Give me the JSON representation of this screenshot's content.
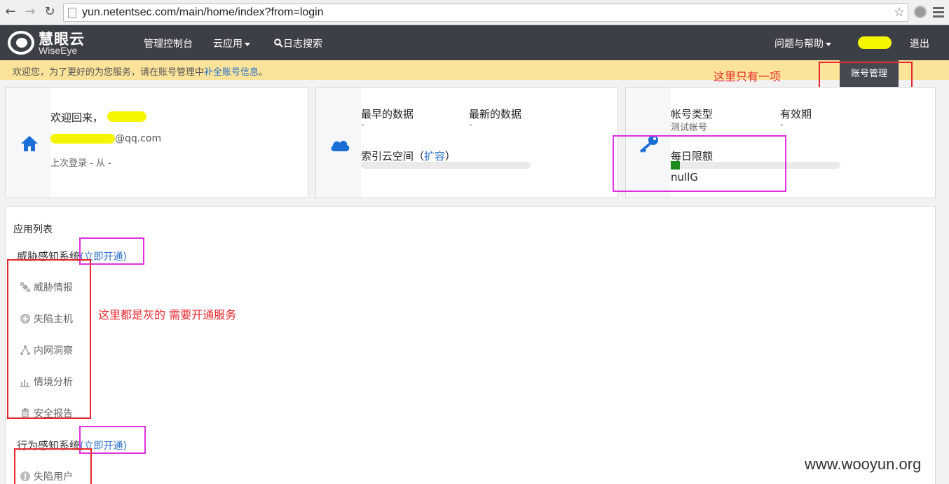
{
  "browser": {
    "url": "yun.netentsec.com/main/home/index?from=login"
  },
  "header": {
    "logo_cn": "慧眼云",
    "logo_en": "WiseEye",
    "nav": [
      "管理控制台",
      "云应用",
      "日志搜索"
    ],
    "help": "问题与帮助",
    "logout": "退出"
  },
  "notice": {
    "text": "欢迎您，为了更好的为您服务，请在账号管理中",
    "link": "补全账号信息",
    "suffix": "。",
    "account_button": "账号管理"
  },
  "annotations": {
    "only_one": "这里只有一项",
    "grey_items": "这里都是灰的 需要开通服务"
  },
  "card_user": {
    "welcome": "欢迎回来，",
    "email_suffix": "@qq.com",
    "last_login": "上次登录 - 从 -"
  },
  "card_data": {
    "earliest_label": "最早的数据",
    "earliest_value": "-",
    "latest_label": "最新的数据",
    "latest_value": "-",
    "space_label": "索引云空间（",
    "space_link": "扩容",
    "space_close": "）"
  },
  "card_account": {
    "type_label": "帐号类型",
    "type_value": "测试帐号",
    "valid_label": "有效期",
    "valid_value": "-",
    "quota_label": "每日限额",
    "quota_value": "nullG"
  },
  "apps": {
    "title": "应用列表",
    "system1": "威胁感知系统",
    "system1_link": "(立即开通)",
    "items1": [
      "威胁情报",
      "失陷主机",
      "内网洞察",
      "情境分析",
      "安全报告"
    ],
    "system2": "行为感知系统",
    "system2_link": "(立即开通)",
    "items2": [
      "失陷用户"
    ]
  },
  "watermark": "www.wooyun.org",
  "colors": {
    "header_bg": "#3d3f46",
    "notice_bg": "#fbe39a",
    "link": "#2a6fc9",
    "icon_blue": "#1a6fd6",
    "annotation_red": "#e8262c",
    "annotation_pink": "#e130e1"
  }
}
